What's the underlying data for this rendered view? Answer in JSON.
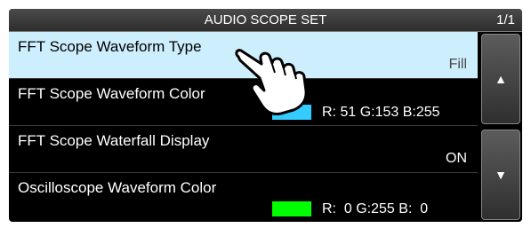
{
  "header": {
    "title": "AUDIO SCOPE SET",
    "page": "1/1"
  },
  "items": [
    {
      "label": "FFT Scope Waveform Type",
      "value": "Fill",
      "selected": true
    },
    {
      "label": "FFT Scope Waveform Color",
      "swatch_color": "#33ccff",
      "rgb_text": "R: 51 G:153 B:255"
    },
    {
      "label": "FFT Scope Waterfall Display",
      "value": "ON"
    },
    {
      "label": "Oscilloscope Waveform Color",
      "swatch_color": "#00ff00",
      "rgb_text": "R:  0 G:255 B:  0"
    }
  ],
  "scroll": {
    "up_icon": "up-arrow-icon",
    "down_icon": "down-arrow-icon"
  },
  "colors": {
    "selected_row": "#cdeefd",
    "background": "#000000"
  },
  "pointer": {
    "icon": "pointing-hand-icon"
  }
}
